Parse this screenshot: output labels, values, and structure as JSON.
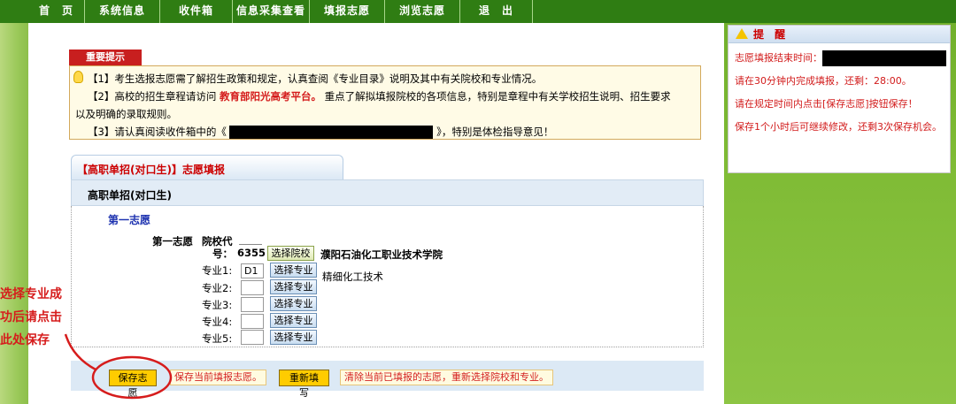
{
  "nav": [
    "首　页",
    "系统信息",
    "收件箱",
    "信息采集查看",
    "填报志愿",
    "浏览志愿",
    "退　出"
  ],
  "notice": {
    "tab": "重要提示",
    "line1": "【1】考生选报志愿需了解招生政策和规定，认真查阅《专业目录》说明及其中有关院校和专业情况。",
    "line2_a": "【2】高校的招生章程请访问",
    "line2_link": "教育部阳光高考平台。",
    "line2_b": "重点了解拟填报院校的各项信息，特别是章程中有关学校招生说明、招生要求",
    "line2_c": "以及明确的录取规则。",
    "line3_a": "【3】请认真阅读收件箱中的《",
    "line3_b": "》，特别是体检指导意见！"
  },
  "form": {
    "tab": "【高职单招(对口生)】志愿填报",
    "header": "高职单招(对口生)",
    "choice_title": "第一志愿",
    "choice_label": "第一志愿",
    "school_code_label_1": "院校代",
    "school_code_label_2": "号：",
    "school_code": "6355",
    "select_school_btn": "选择院校",
    "school_name": "濮阳石油化工职业技术学院",
    "majors": [
      {
        "label": "专业1:",
        "value": "D1",
        "btn": "选择专业",
        "name": "精细化工技术"
      },
      {
        "label": "专业2:",
        "value": "",
        "btn": "选择专业",
        "name": ""
      },
      {
        "label": "专业3:",
        "value": "",
        "btn": "选择专业",
        "name": ""
      },
      {
        "label": "专业4:",
        "value": "",
        "btn": "选择专业",
        "name": ""
      },
      {
        "label": "专业5:",
        "value": "",
        "btn": "选择专业",
        "name": ""
      }
    ]
  },
  "bottom": {
    "save_btn": "保存志愿",
    "save_hint": "保存当前填报志愿。",
    "reset_btn": "重新填写",
    "reset_hint": "清除当前已填报的志愿，重新选择院校和专业。"
  },
  "tips": {
    "title": "提 醒",
    "line1": "志愿填报结束时间：",
    "line2": "请在30分钟内完成填报，还剩：28:00。",
    "line3": "请在规定时间内点击[保存志愿]按钮保存！",
    "line4": "保存1个小时后可继续修改，还剩3次保存机会。"
  },
  "annotation": [
    "选择专业成",
    "功后请点击",
    "此处保存"
  ]
}
